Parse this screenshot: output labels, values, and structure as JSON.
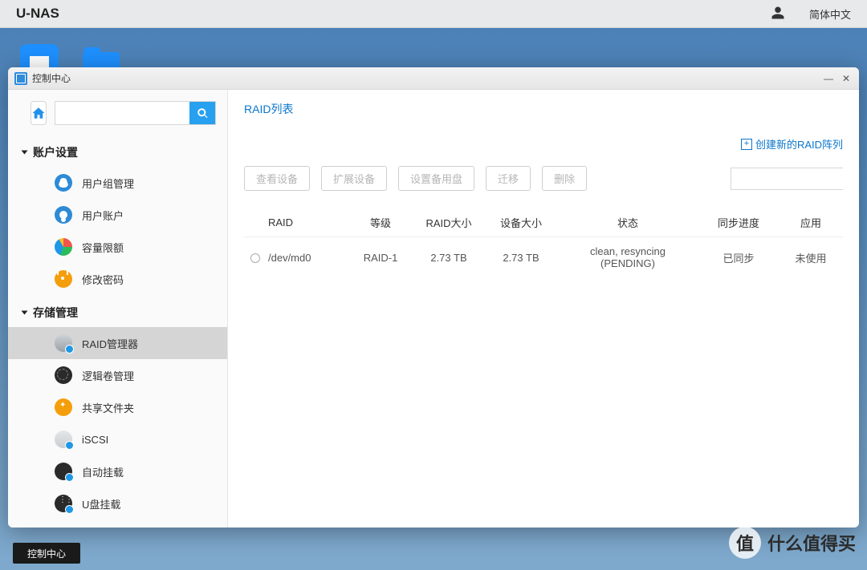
{
  "topbar": {
    "logo": "U-NAS",
    "language": "简体中文"
  },
  "taskbar": {
    "app": "控制中心"
  },
  "window": {
    "title": "控制中心"
  },
  "sidebar": {
    "groups": [
      {
        "title": "账户设置",
        "items": [
          {
            "label": "用户组管理"
          },
          {
            "label": "用户账户"
          },
          {
            "label": "容量限额"
          },
          {
            "label": "修改密码"
          }
        ]
      },
      {
        "title": "存储管理",
        "items": [
          {
            "label": "RAID管理器"
          },
          {
            "label": "逻辑卷管理"
          },
          {
            "label": "共享文件夹"
          },
          {
            "label": "iSCSI"
          },
          {
            "label": "自动挂载"
          },
          {
            "label": "U盘挂载"
          }
        ]
      }
    ]
  },
  "main": {
    "title": "RAID列表",
    "create_link": "创建新的RAID阵列",
    "buttons": {
      "view": "查看设备",
      "extend": "扩展设备",
      "spare": "设置备用盘",
      "migrate": "迁移",
      "delete": "删除"
    },
    "columns": {
      "raid": "RAID",
      "level": "等级",
      "raid_size": "RAID大小",
      "dev_size": "设备大小",
      "status": "状态",
      "sync": "同步进度",
      "app": "应用"
    },
    "rows": [
      {
        "raid": "/dev/md0",
        "level": "RAID-1",
        "raid_size": "2.73 TB",
        "dev_size": "2.73 TB",
        "status": "clean, resyncing (PENDING)",
        "sync": "已同步",
        "app": "未使用"
      }
    ]
  },
  "watermark": "值 什么值得买"
}
